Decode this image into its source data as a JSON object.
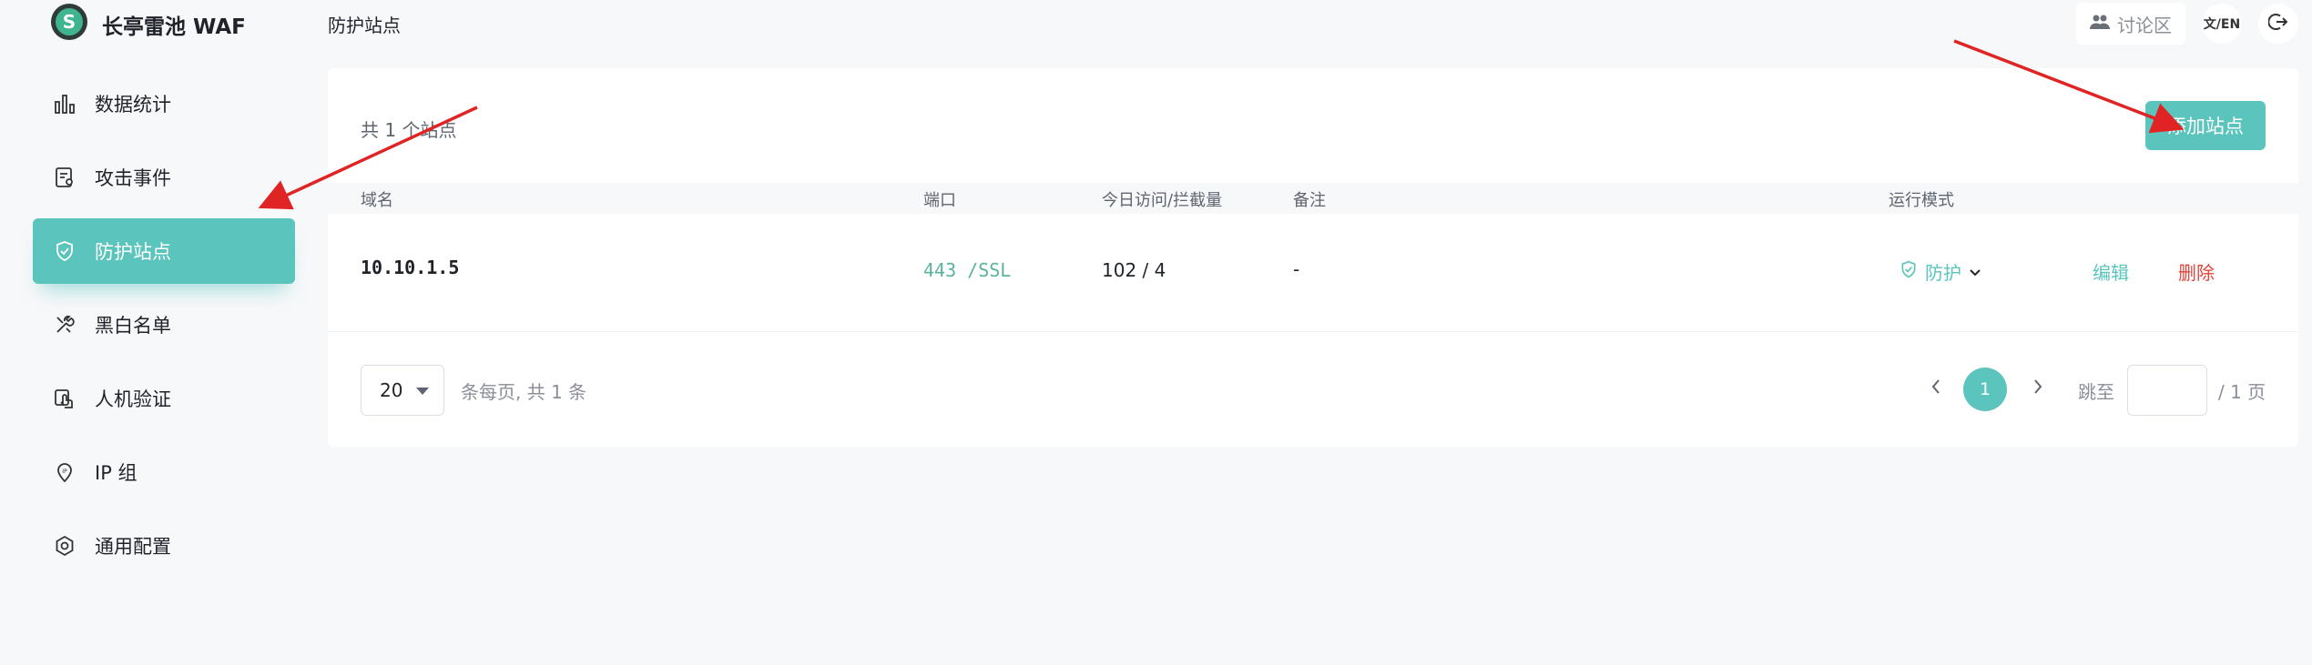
{
  "app": {
    "title": "长亭雷池 WAF",
    "logo_icon": "shield-s-logo-icon"
  },
  "header": {
    "breadcrumb": "防护站点",
    "forum_label": "讨论区",
    "lang_label": "文/EN",
    "logout_icon": "logout-icon"
  },
  "sidebar": {
    "items": [
      {
        "label": "数据统计",
        "icon": "bar-chart-icon",
        "active": false
      },
      {
        "label": "攻击事件",
        "icon": "event-log-icon",
        "active": false
      },
      {
        "label": "防护站点",
        "icon": "shield-check-icon",
        "active": true
      },
      {
        "label": "黑白名单",
        "icon": "tools-icon",
        "active": false
      },
      {
        "label": "人机验证",
        "icon": "hand-touch-icon",
        "active": false
      },
      {
        "label": "IP 组",
        "icon": "ip-pin-icon",
        "active": false
      },
      {
        "label": "通用配置",
        "icon": "settings-gear-icon",
        "active": false
      }
    ]
  },
  "main": {
    "count_text": "共 1 个站点",
    "add_button": "添加站点",
    "table": {
      "headers": {
        "domain": "域名",
        "port": "端口",
        "visits": "今日访问/拦截量",
        "note": "备注",
        "mode": "运行模式"
      },
      "rows": [
        {
          "domain": "10.10.1.5",
          "port": "443 /SSL",
          "visits": "102 / 4",
          "note": "-",
          "mode": "防护",
          "edit": "编辑",
          "delete": "删除"
        }
      ]
    },
    "pagination": {
      "page_size": "20",
      "per_page_text": "条每页, 共 1 条",
      "current_page": "1",
      "goto_label": "跳至",
      "goto_value": "",
      "total_pages_text": "/ 1 页"
    }
  },
  "colors": {
    "accent": "#5bc5bd",
    "danger": "#e0433a",
    "port_text": "#5bb39b",
    "annotation_arrow": "#e02424"
  }
}
